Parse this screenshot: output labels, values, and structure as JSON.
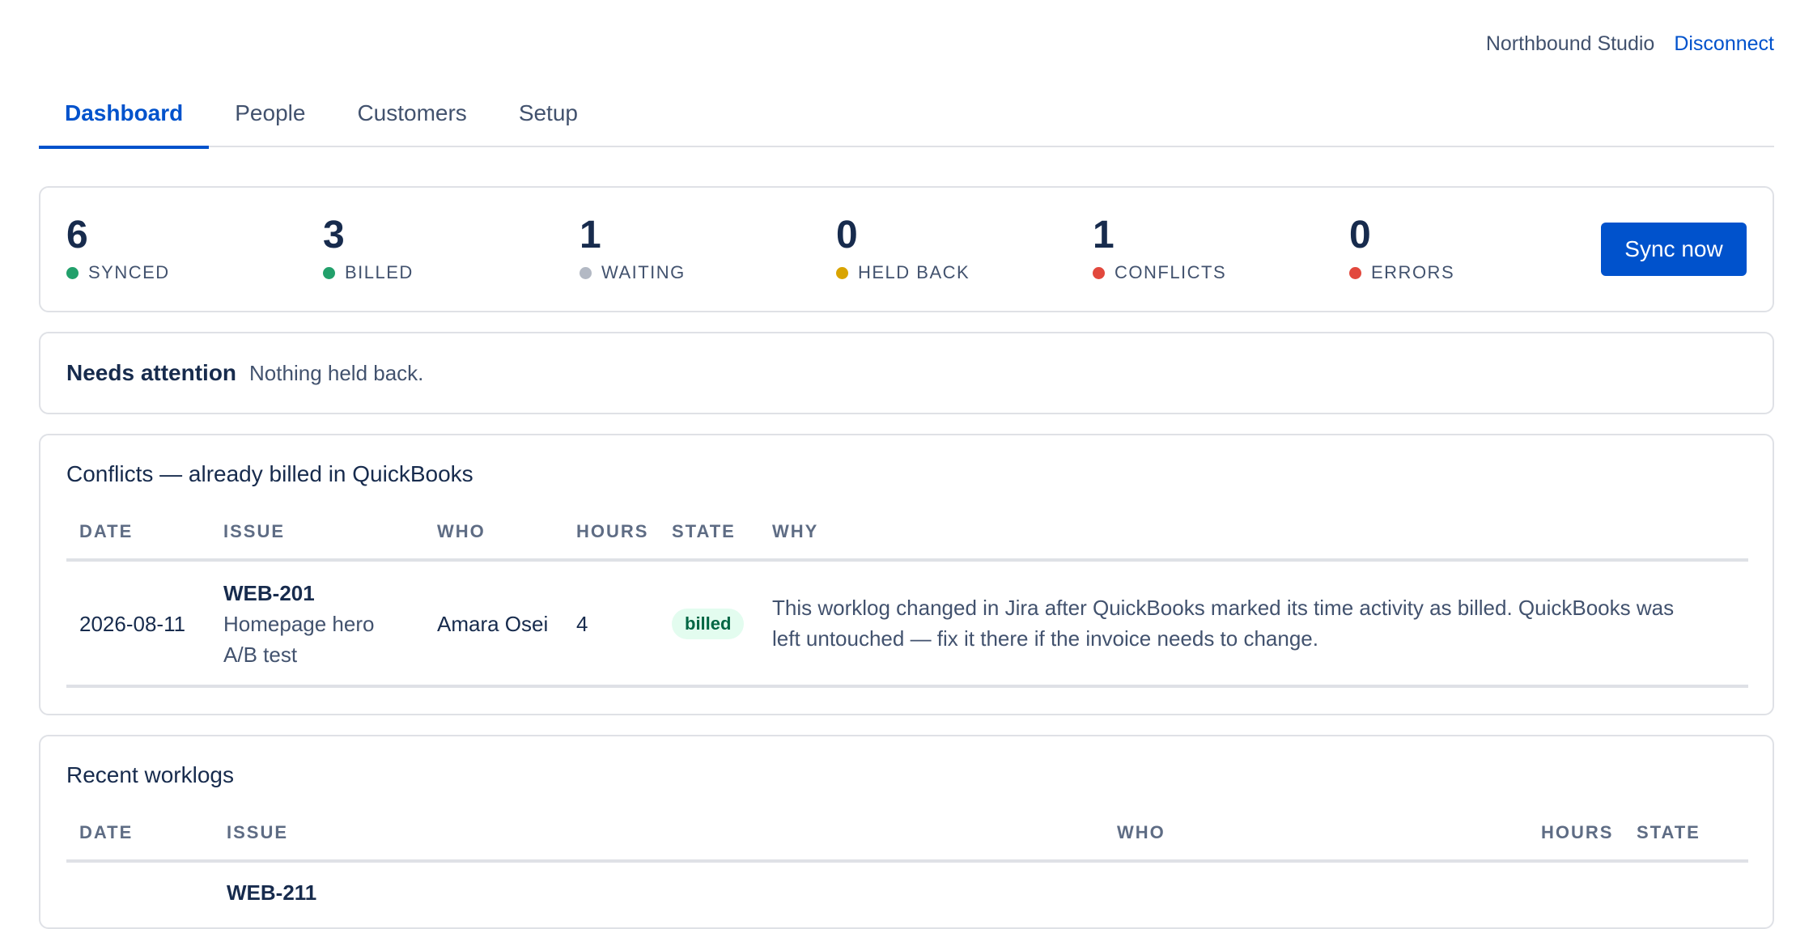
{
  "header": {
    "workspace_name": "Northbound Studio",
    "disconnect_label": "Disconnect"
  },
  "tabs": [
    {
      "label": "Dashboard",
      "active": true
    },
    {
      "label": "People",
      "active": false
    },
    {
      "label": "Customers",
      "active": false
    },
    {
      "label": "Setup",
      "active": false
    }
  ],
  "stats": [
    {
      "value": "6",
      "label": "SYNCED",
      "color": "#22a06b"
    },
    {
      "value": "3",
      "label": "BILLED",
      "color": "#22a06b"
    },
    {
      "value": "1",
      "label": "WAITING",
      "color": "#b3b9c4"
    },
    {
      "value": "0",
      "label": "HELD BACK",
      "color": "#d9a400"
    },
    {
      "value": "1",
      "label": "CONFLICTS",
      "color": "#e2483d"
    },
    {
      "value": "0",
      "label": "ERRORS",
      "color": "#e2483d"
    }
  ],
  "sync_button_label": "Sync now",
  "attention": {
    "title": "Needs attention",
    "text": "Nothing held back."
  },
  "conflicts": {
    "title": "Conflicts — already billed in QuickBooks",
    "columns": [
      "DATE",
      "ISSUE",
      "WHO",
      "HOURS",
      "STATE",
      "WHY"
    ],
    "rows": [
      {
        "date": "2026-08-11",
        "issue_key": "WEB-201",
        "issue_summary_line1": "Homepage hero",
        "issue_summary_line2": "A/B test",
        "who": "Amara Osei",
        "hours": "4",
        "state": "billed",
        "why_line1": "This worklog changed in Jira after QuickBooks marked its time activity as billed. QuickBooks was",
        "why_line2": "left untouched — fix it there if the invoice needs to change."
      }
    ]
  },
  "recent": {
    "title": "Recent worklogs",
    "columns": [
      "DATE",
      "ISSUE",
      "WHO",
      "HOURS",
      "STATE"
    ],
    "partial_row_issue_key": "WEB-211"
  }
}
